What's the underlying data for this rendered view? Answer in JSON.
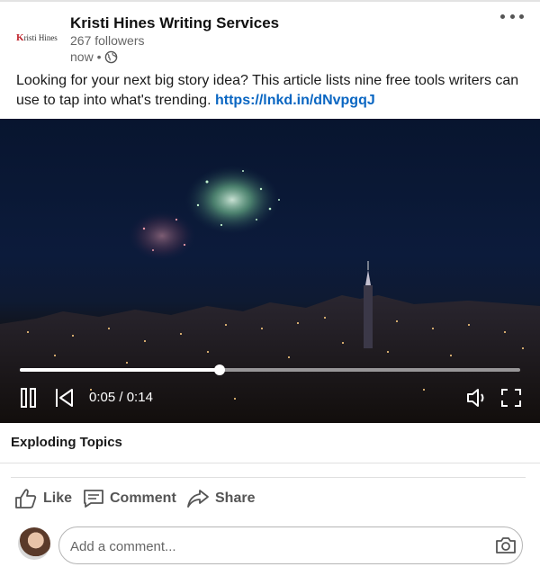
{
  "post": {
    "author_name": "Kristi Hines Writing Services",
    "followers": "267 followers",
    "time": "now •",
    "logo_text_prefix": "K",
    "logo_text_rest": "risti Hines",
    "body_text": "Looking for your next big story idea? This article lists nine free tools writers can use to tap into what's trending.",
    "link_text": "https://lnkd.in/dNvpgqJ"
  },
  "video": {
    "current_time": "0:05",
    "separator": " / ",
    "duration": "0:14",
    "progress_fraction": 0.4,
    "caption": "Exploding Topics"
  },
  "actions": {
    "like": "Like",
    "comment": "Comment",
    "share": "Share"
  },
  "comment_box": {
    "placeholder": "Add a comment..."
  },
  "colors": {
    "link": "#0a66c2",
    "action_text": "#555555"
  },
  "icons": [
    "more-options-icon",
    "globe-icon",
    "pause-icon",
    "skip-back-icon",
    "volume-icon",
    "fullscreen-icon",
    "thumbs-up-icon",
    "comment-icon",
    "share-arrow-icon",
    "camera-icon"
  ]
}
